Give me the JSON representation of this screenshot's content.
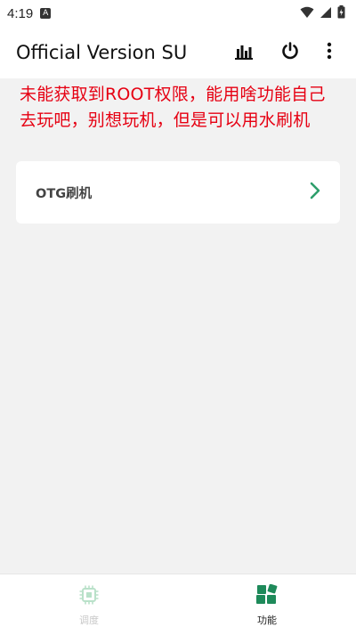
{
  "status_bar": {
    "time": "4:19",
    "notification_icon": "A"
  },
  "app_bar": {
    "title": "Official Version SU",
    "actions": [
      "chart-icon",
      "power-icon",
      "more-vert-icon"
    ]
  },
  "warning_text": "未能获取到ROOT权限，能用啥功能自己去玩吧，别想玩机，但是可以用水刷机",
  "card": {
    "label": "OTG刷机",
    "chevron_color": "#2e9e6b"
  },
  "bottom_nav": {
    "items": [
      {
        "label": "调度",
        "icon": "chip-icon",
        "active": false
      },
      {
        "label": "功能",
        "icon": "blocks-icon",
        "active": true
      }
    ]
  },
  "colors": {
    "accent": "#2e9e6b",
    "warning": "#e60012",
    "inactive": "#c8c8c8"
  }
}
